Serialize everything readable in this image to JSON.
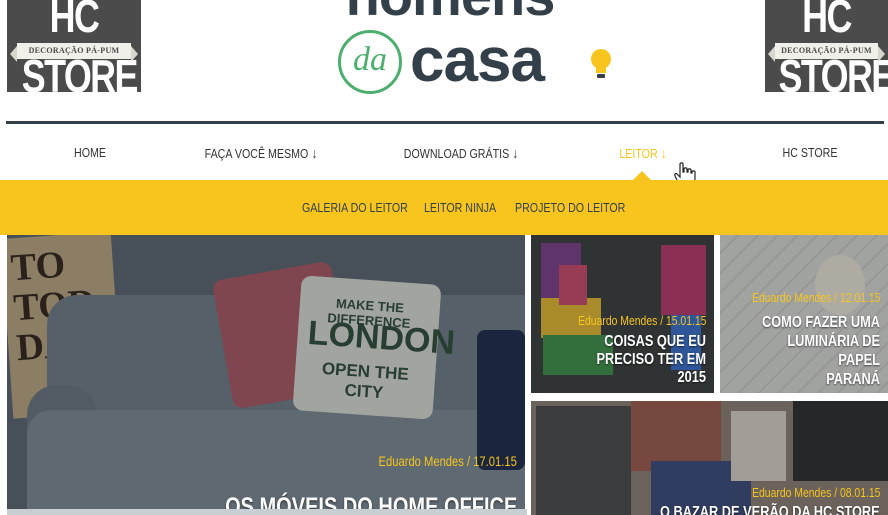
{
  "header": {
    "ad_left": {
      "brand": "HC STORE",
      "tagline": "DECORAÇÃO PÁ-PUM"
    },
    "ad_right": {
      "brand": "HC STORE",
      "tagline": "DECORAÇÃO PÁ-PUM"
    },
    "logo": {
      "top": "homens",
      "da": "da",
      "casa": "casa"
    }
  },
  "nav": {
    "items": [
      {
        "label": "HOME"
      },
      {
        "label": "FAÇA VOCÊ MESMO",
        "arrow": "↓"
      },
      {
        "label": "DOWNLOAD GRÁTIS",
        "arrow": "↓"
      },
      {
        "label": "LEITOR",
        "arrow": "↓",
        "active": true
      },
      {
        "label": "HC STORE"
      }
    ]
  },
  "subnav": {
    "items": [
      {
        "label": "GALERIA DO LEITOR"
      },
      {
        "label": "LEITOR NINJA"
      },
      {
        "label": "PROJETO DO LEITOR"
      }
    ]
  },
  "posts": [
    {
      "meta": "Eduardo Mendes  /  17.01.15",
      "title": "OS MÓVEIS DO HOME OFFICE"
    },
    {
      "meta": "Eduardo Mendes  /  15.01.15",
      "title_lines": [
        "COISAS QUE EU",
        "PRECISO TER EM 2015"
      ]
    },
    {
      "meta": "Eduardo Mendes  /  12.01.15",
      "title_lines": [
        "COMO FAZER UMA",
        "LUMINÁRIA DE PAPEL",
        "PARANÁ"
      ]
    },
    {
      "meta": "Eduardo Mendes  /  08.01.15",
      "title": "O BAZAR DE VERÃO DA HC STORE"
    }
  ],
  "big_scene": {
    "sign": "TO\nTOD\nDAY",
    "pillow_lines": [
      "MAKE THE DIFFERENCE",
      "LONDON",
      "OPEN THE CITY"
    ]
  },
  "colors": {
    "accent": "#f7c51e",
    "dark": "#33404a",
    "green": "#4caf6d"
  }
}
